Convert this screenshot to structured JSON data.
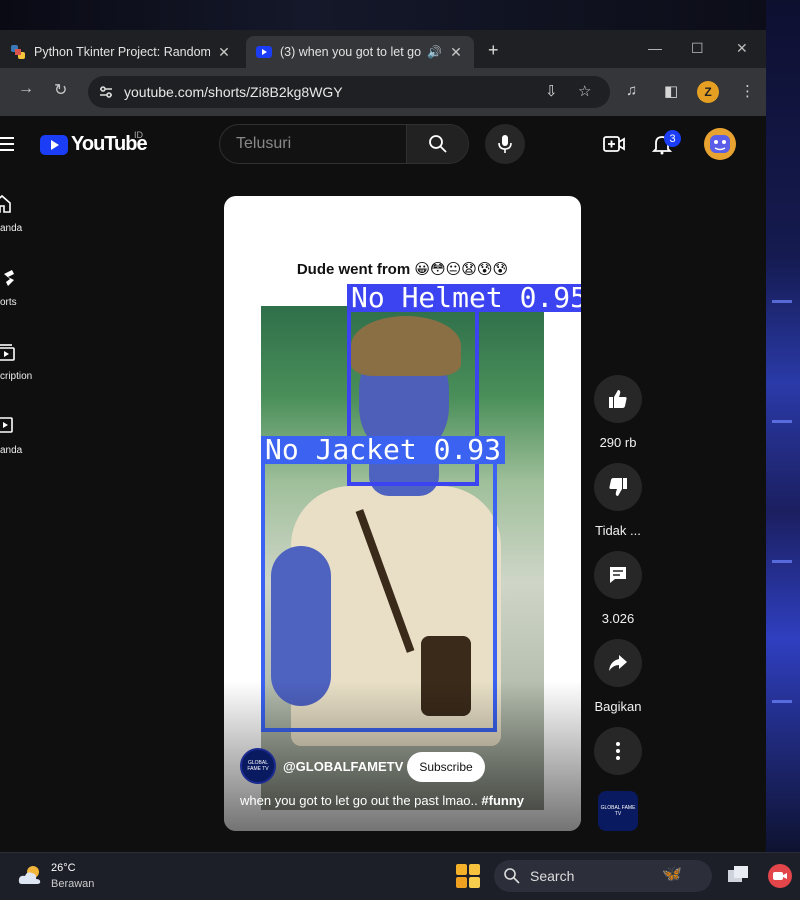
{
  "browser": {
    "tabs": [
      {
        "title": "Python Tkinter Project: Random",
        "active": false
      },
      {
        "title": "(3) when you got to let go o",
        "active": true
      }
    ],
    "url": "youtube.com/shorts/Zi8B2kg8WGY",
    "profile_initial": "Z"
  },
  "youtube": {
    "logo_text": "YouTube",
    "country_code": "ID",
    "search_placeholder": "Telusuri",
    "notification_count": "3",
    "sidebar": [
      {
        "label": "anda",
        "icon": "home-icon"
      },
      {
        "label": "orts",
        "icon": "shorts-icon"
      },
      {
        "label": "cription",
        "icon": "subscriptions-icon"
      },
      {
        "label": "anda",
        "icon": "library-icon"
      }
    ],
    "short": {
      "overlay_caption": "Dude went from 😀😳😐😧😰😰",
      "detections": [
        {
          "label": "No Helmet 0.95",
          "color": "#3b44f0"
        },
        {
          "label": "No Jacket 0.93",
          "color": "#3b62f0"
        }
      ],
      "channel_avatar_text": "GLOBAL FAME TV",
      "channel": "@GLOBALFAMETV",
      "subscribe_label": "Subscribe",
      "title": "when you got to let go out the past lmao.. ",
      "hashtag": "#funny"
    },
    "actions": [
      {
        "label": "290 rb",
        "icon": "like-icon"
      },
      {
        "label": "Tidak ...",
        "icon": "dislike-icon"
      },
      {
        "label": "3.026",
        "icon": "comment-icon"
      },
      {
        "label": "Bagikan",
        "icon": "share-icon"
      },
      {
        "label": "",
        "icon": "more-icon"
      }
    ]
  },
  "taskbar": {
    "temperature": "26°C",
    "weather": "Berawan",
    "search_label": "Search"
  }
}
